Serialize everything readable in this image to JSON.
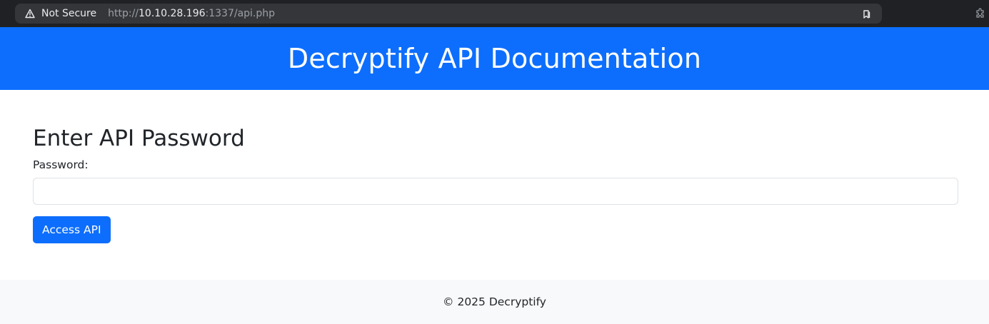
{
  "browser": {
    "security_label": "Not Secure",
    "url_scheme": "http://",
    "url_host": "10.10.28.196",
    "url_rest": ":1337/api.php"
  },
  "header": {
    "title": "Decryptify API Documentation"
  },
  "main": {
    "heading": "Enter API Password",
    "password_label": "Password:",
    "password_value": "",
    "submit_label": "Access API"
  },
  "footer": {
    "text": "© 2025 Decryptify"
  },
  "colors": {
    "primary": "#0d6efd",
    "footer_bg": "#f8f9fa",
    "chrome_bg": "#202124"
  },
  "icons": [
    "warning-icon",
    "bookmark-icon",
    "extensions-icon"
  ]
}
